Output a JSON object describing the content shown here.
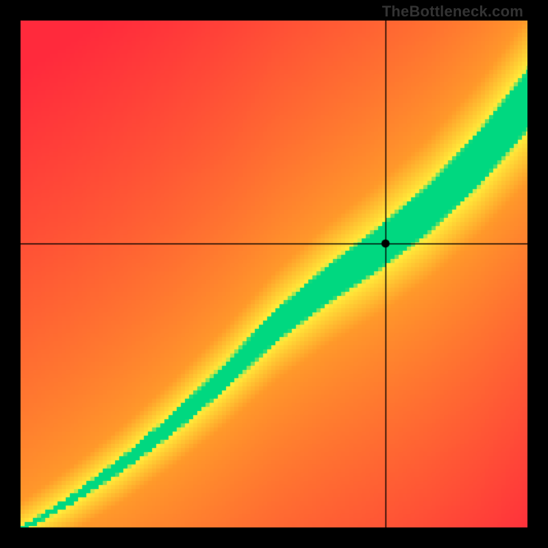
{
  "watermark": "TheBottleneck.com",
  "colors": {
    "red": "#ff2a3c",
    "orange": "#ff9a2a",
    "yellow": "#ffee3a",
    "green": "#00d880",
    "crosshair": "#000000",
    "marker": "#000000"
  },
  "chart_data": {
    "type": "heatmap",
    "title": "",
    "xlabel": "",
    "ylabel": "",
    "x_range": [
      0,
      1
    ],
    "y_range": [
      0,
      1
    ],
    "marker": {
      "x": 0.72,
      "y": 0.56,
      "radius_px": 6
    },
    "crosshair": {
      "x": 0.72,
      "y": 0.56
    },
    "optimal_ridge": {
      "description": "green band = balanced CPU/GPU; y ≈ f(x) below",
      "samples": [
        {
          "x": 0.0,
          "y": 0.0
        },
        {
          "x": 0.1,
          "y": 0.06
        },
        {
          "x": 0.2,
          "y": 0.13
        },
        {
          "x": 0.3,
          "y": 0.21
        },
        {
          "x": 0.4,
          "y": 0.3
        },
        {
          "x": 0.5,
          "y": 0.4
        },
        {
          "x": 0.6,
          "y": 0.48
        },
        {
          "x": 0.7,
          "y": 0.55
        },
        {
          "x": 0.8,
          "y": 0.63
        },
        {
          "x": 0.9,
          "y": 0.73
        },
        {
          "x": 1.0,
          "y": 0.85
        }
      ],
      "green_halfwidth_start": 0.005,
      "green_halfwidth_end": 0.07,
      "yellow_halfwidth_extra": 0.1
    },
    "color_scale_note": "distance from ridge maps red→orange→yellow→green (closest)"
  }
}
